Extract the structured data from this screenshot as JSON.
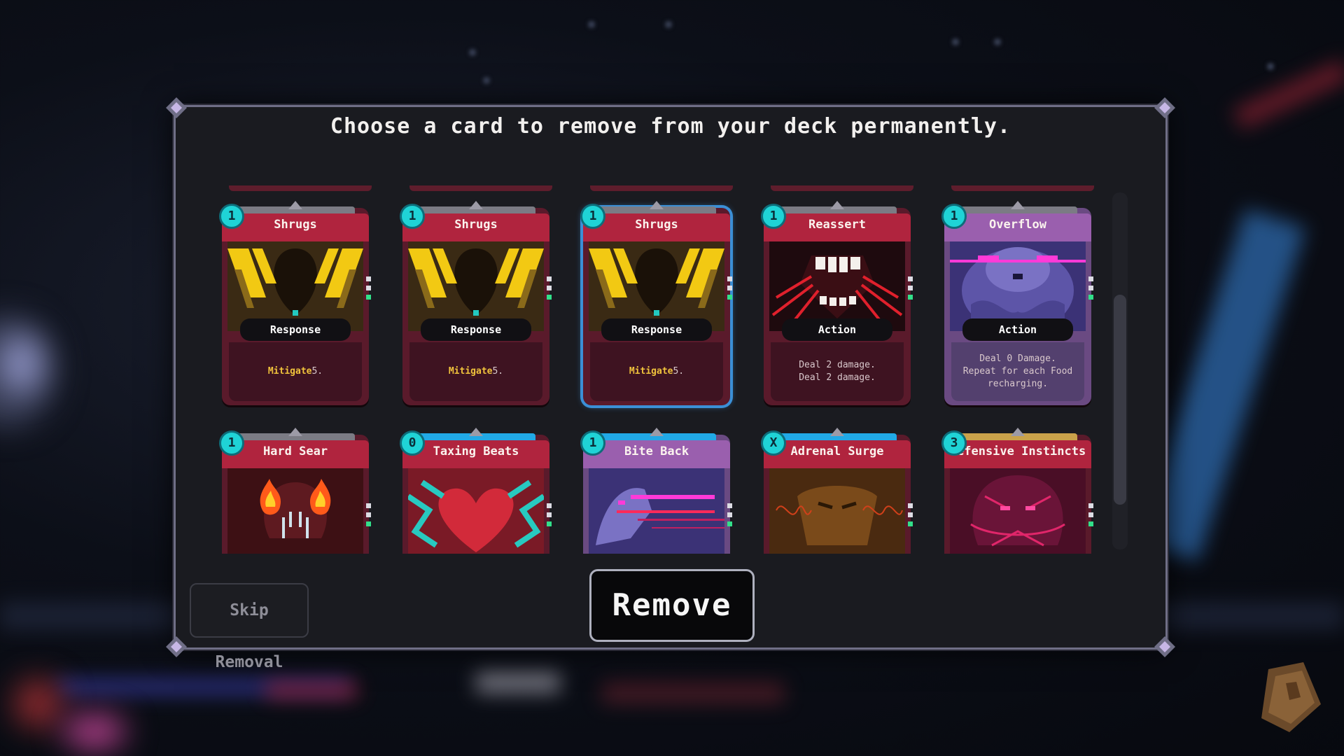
{
  "dialog": {
    "title": "Choose a card to remove from your deck permanently."
  },
  "cards": [
    {
      "name": "Shrugs",
      "cost": "1",
      "type": "Response",
      "desc_kw": "Mitigate",
      "desc": " 5."
    },
    {
      "name": "Shrugs",
      "cost": "1",
      "type": "Response",
      "desc_kw": "Mitigate",
      "desc": " 5."
    },
    {
      "name": "Shrugs",
      "cost": "1",
      "type": "Response",
      "desc_kw": "Mitigate",
      "desc": " 5.",
      "selected": true
    },
    {
      "name": "Reassert",
      "cost": "1",
      "type": "Action",
      "desc_kw": "",
      "desc": "Deal 2 damage.\nDeal 2 damage."
    },
    {
      "name": "Overflow",
      "cost": "1",
      "type": "Action",
      "desc_kw": "",
      "desc": "Deal 0 Damage.\nRepeat for each Food\nrecharging."
    },
    {
      "name": "Hard Sear",
      "cost": "1"
    },
    {
      "name": "Taxing Beats",
      "cost": "0"
    },
    {
      "name": "Bite Back",
      "cost": "1"
    },
    {
      "name": "Adrenal Surge",
      "cost": "X"
    },
    {
      "name": "Defensive Instincts",
      "cost": "3"
    }
  ],
  "buttons": {
    "skip": "Skip Removal",
    "remove": "Remove"
  },
  "colors": {
    "accent_selected": "#3b8fd6",
    "cost_badge": "#1fd3d6",
    "keyword": "#f0c33c",
    "card_red": "#b0243e",
    "card_purple": "#9a5fae"
  },
  "icons": {
    "cost": "cost-gem-icon",
    "corner": "corner-ornament-icon",
    "backpack": "backpack-icon"
  }
}
